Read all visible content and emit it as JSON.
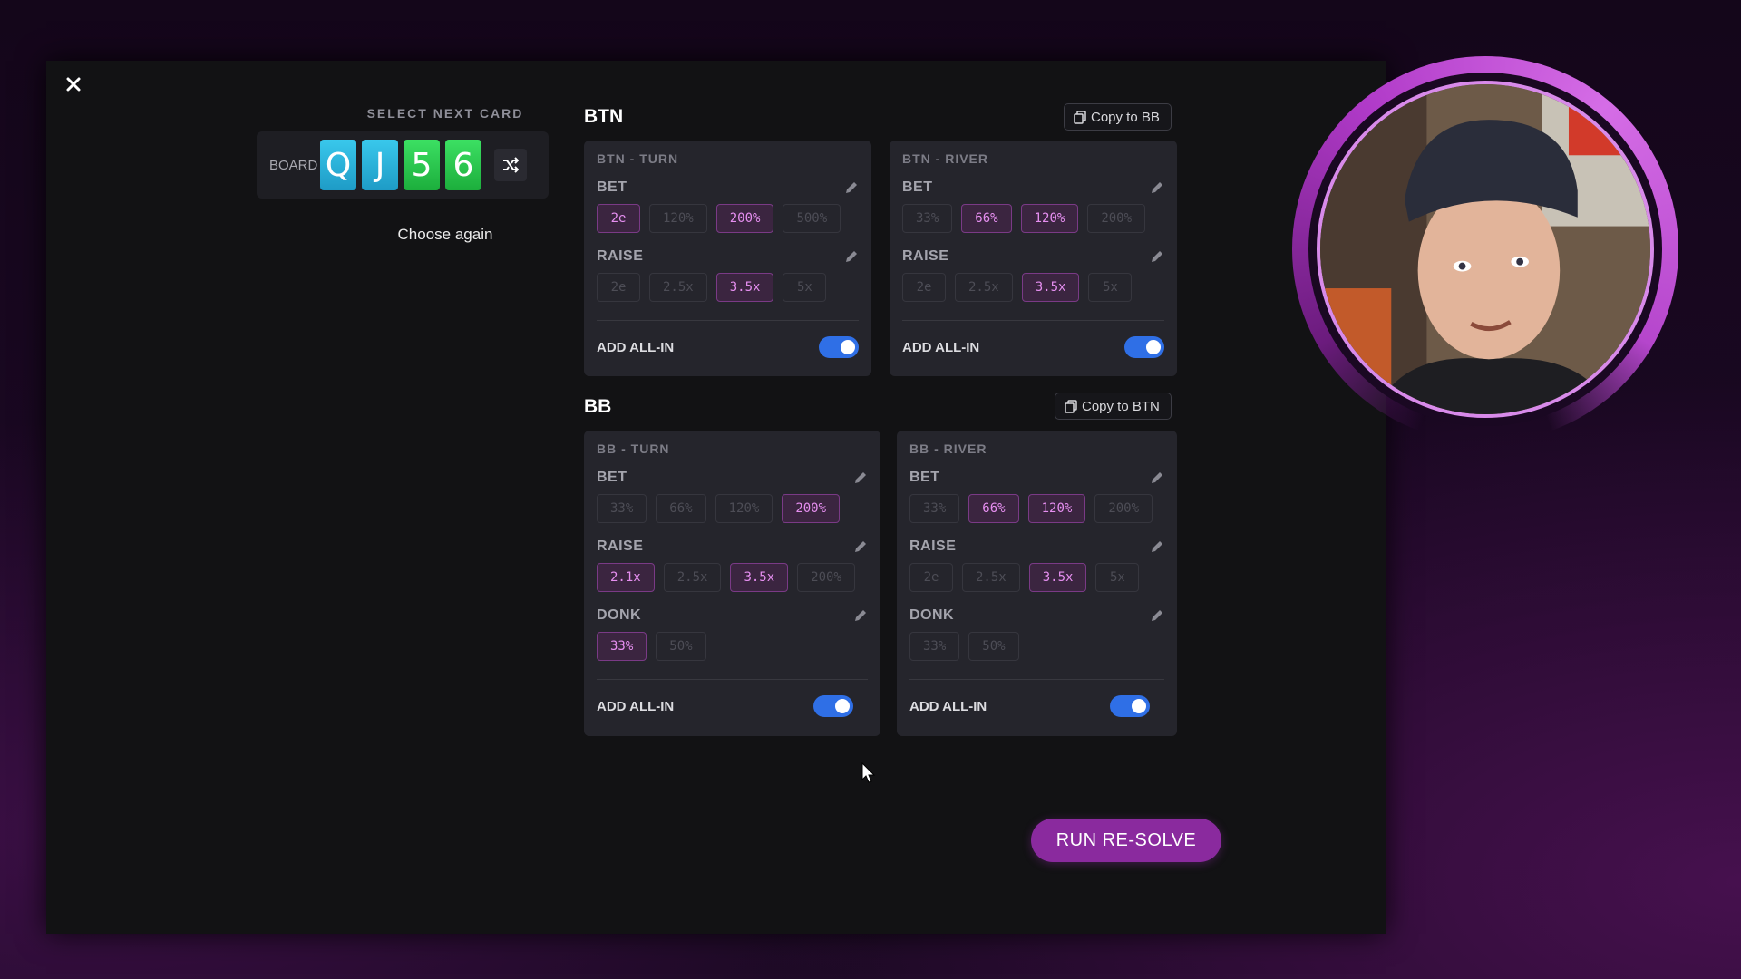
{
  "close_icon": "close-icon",
  "selector": {
    "label": "SELECT NEXT CARD",
    "board_label": "BOARD",
    "cards": [
      {
        "rank": "Q",
        "color": "blue"
      },
      {
        "rank": "J",
        "color": "blue"
      },
      {
        "rank": "5",
        "color": "green"
      },
      {
        "rank": "6",
        "color": "green"
      }
    ],
    "shuffle_icon": "shuffle-icon",
    "choose_again": "Choose again"
  },
  "btn": {
    "title": "BTN",
    "copy_label": "Copy to BB",
    "turn": {
      "title": "BTN - TURN",
      "bet_label": "BET",
      "bet": [
        {
          "v": "2e",
          "on": true
        },
        {
          "v": "120%",
          "on": false
        },
        {
          "v": "200%",
          "on": true
        },
        {
          "v": "500%",
          "on": false
        }
      ],
      "raise_label": "RAISE",
      "raise": [
        {
          "v": "2e",
          "on": false
        },
        {
          "v": "2.5x",
          "on": false
        },
        {
          "v": "3.5x",
          "on": true
        },
        {
          "v": "5x",
          "on": false
        }
      ],
      "allin_label": "ADD ALL-IN",
      "allin": true
    },
    "river": {
      "title": "BTN - RIVER",
      "bet_label": "BET",
      "bet": [
        {
          "v": "33%",
          "on": false
        },
        {
          "v": "66%",
          "on": true
        },
        {
          "v": "120%",
          "on": true
        },
        {
          "v": "200%",
          "on": false
        }
      ],
      "raise_label": "RAISE",
      "raise": [
        {
          "v": "2e",
          "on": false
        },
        {
          "v": "2.5x",
          "on": false
        },
        {
          "v": "3.5x",
          "on": true
        },
        {
          "v": "5x",
          "on": false
        }
      ],
      "allin_label": "ADD ALL-IN",
      "allin": true
    }
  },
  "bb": {
    "title": "BB",
    "copy_label": "Copy to BTN",
    "turn": {
      "title": "BB - TURN",
      "bet_label": "BET",
      "bet": [
        {
          "v": "33%",
          "on": false
        },
        {
          "v": "66%",
          "on": false
        },
        {
          "v": "120%",
          "on": false
        },
        {
          "v": "200%",
          "on": true
        }
      ],
      "raise_label": "RAISE",
      "raise": [
        {
          "v": "2.1x",
          "on": true
        },
        {
          "v": "2.5x",
          "on": false
        },
        {
          "v": "3.5x",
          "on": true
        },
        {
          "v": "200%",
          "on": false
        }
      ],
      "donk_label": "DONK",
      "donk": [
        {
          "v": "33%",
          "on": true
        },
        {
          "v": "50%",
          "on": false
        }
      ],
      "allin_label": "ADD ALL-IN",
      "allin": true
    },
    "river": {
      "title": "BB - RIVER",
      "bet_label": "BET",
      "bet": [
        {
          "v": "33%",
          "on": false
        },
        {
          "v": "66%",
          "on": true
        },
        {
          "v": "120%",
          "on": true
        },
        {
          "v": "200%",
          "on": false
        }
      ],
      "raise_label": "RAISE",
      "raise": [
        {
          "v": "2e",
          "on": false
        },
        {
          "v": "2.5x",
          "on": false
        },
        {
          "v": "3.5x",
          "on": true
        },
        {
          "v": "5x",
          "on": false
        }
      ],
      "donk_label": "DONK",
      "donk": [
        {
          "v": "33%",
          "on": false
        },
        {
          "v": "50%",
          "on": false
        }
      ],
      "allin_label": "ADD ALL-IN",
      "allin": true
    }
  },
  "run_label": "RUN RE-SOLVE",
  "colors": {
    "accent_purple": "#8a2a9e",
    "toggle_blue": "#2f6fe6",
    "card_blue": "#2bb5de",
    "card_green": "#2bcf50"
  }
}
